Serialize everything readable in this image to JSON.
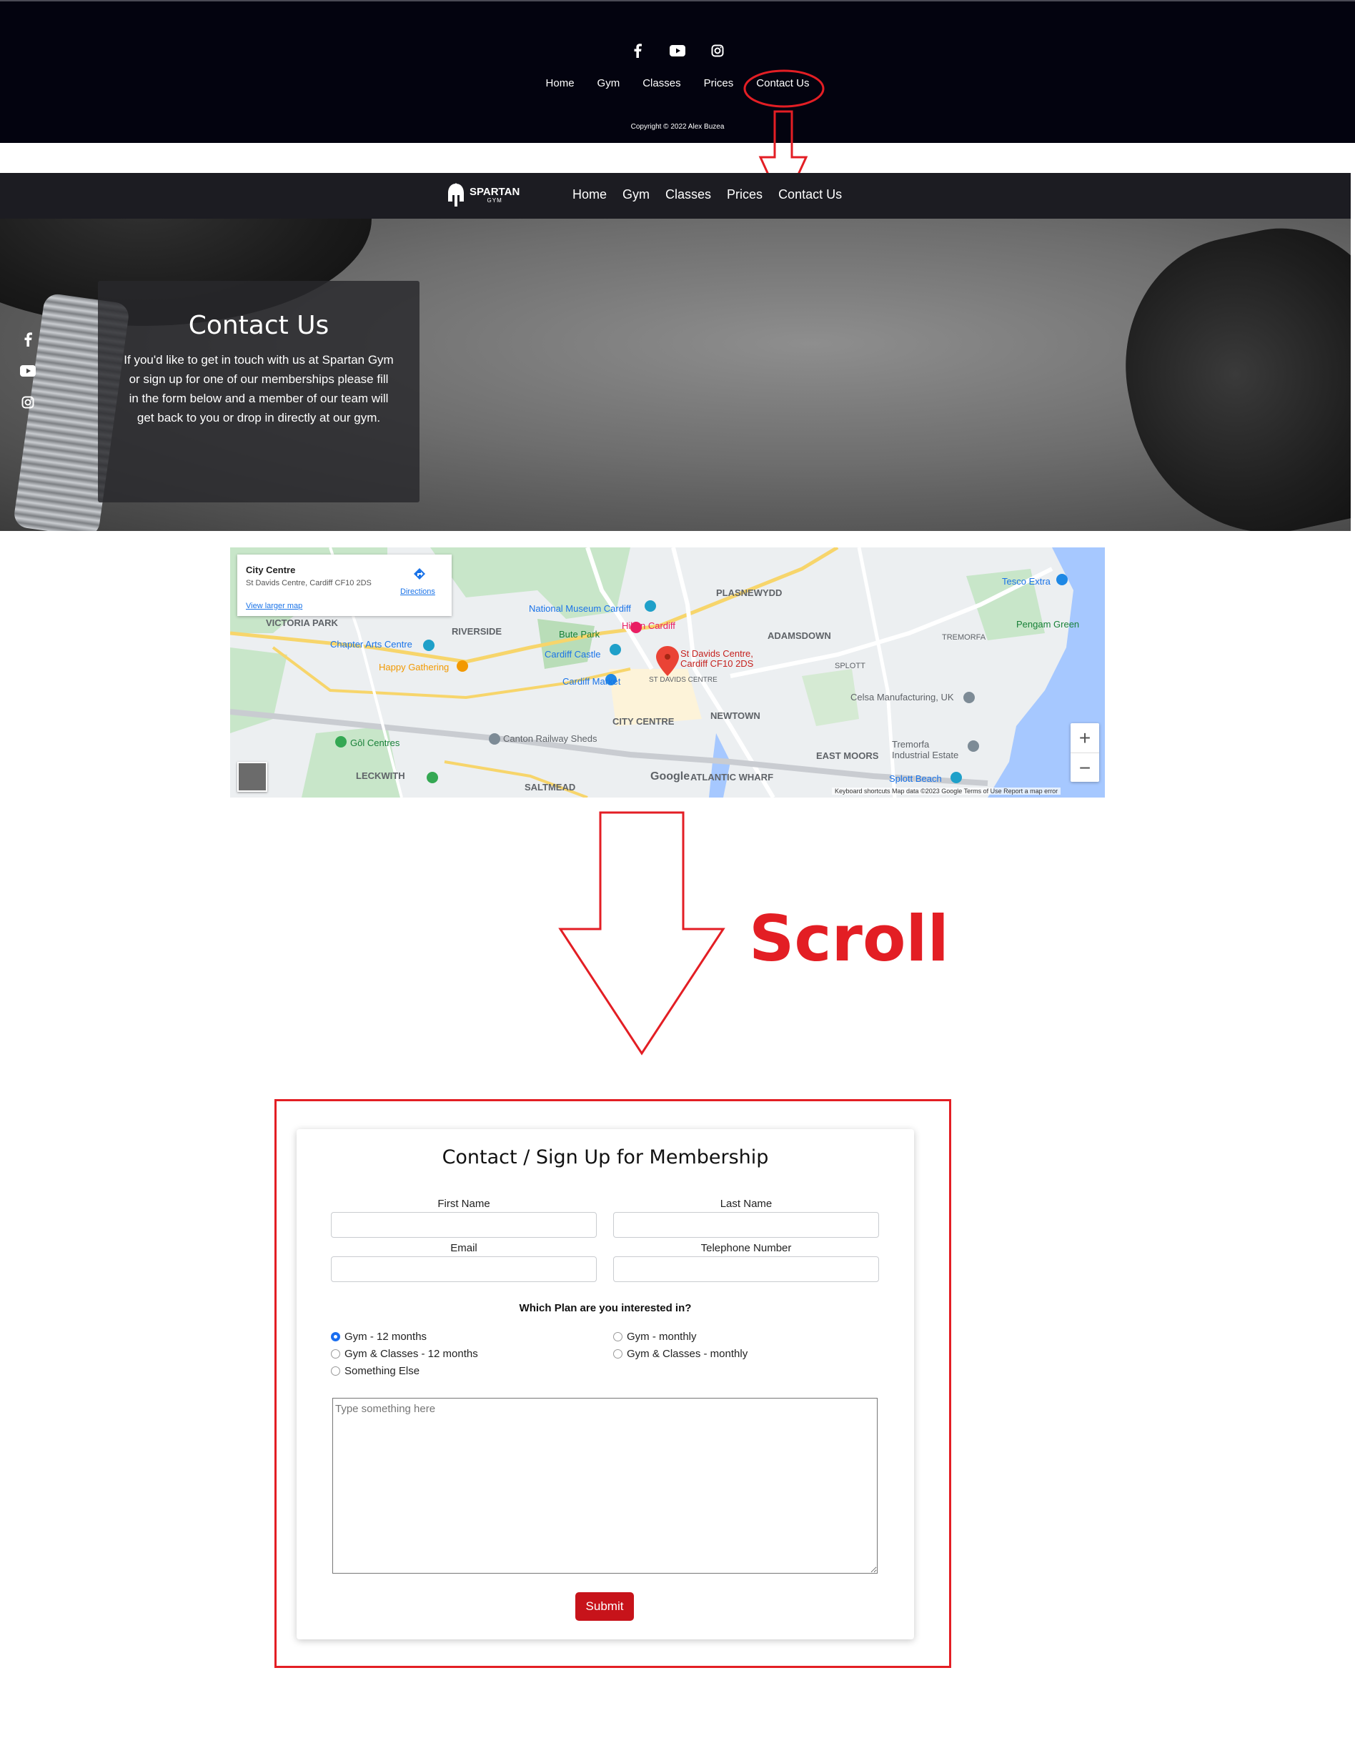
{
  "footer": {
    "social": [
      "facebook-icon",
      "youtube-icon",
      "instagram-icon"
    ],
    "nav": [
      "Home",
      "Gym",
      "Classes",
      "Prices",
      "Contact Us"
    ],
    "copyright": "Copyright © 2022 Alex Buzea"
  },
  "navbar": {
    "brand_title": "SPARTAN",
    "brand_sub": "GYM",
    "links": [
      "Home",
      "Gym",
      "Classes",
      "Prices",
      "Contact Us"
    ]
  },
  "hero": {
    "title": "Contact Us",
    "text": "If you'd like to get in touch with us at Spartan Gym or sign up for one of our memberships please fill in the form below and a member of our team will get back to you or drop in directly at our gym.",
    "social": [
      "facebook-icon",
      "youtube-icon",
      "instagram-icon"
    ]
  },
  "map": {
    "place_title": "City Centre",
    "address": "St Davids Centre, Cardiff CF10 2DS",
    "view_larger": "View larger map",
    "directions": "Directions",
    "marker_label": "St Davids Centre, Cardiff CF10 2DS",
    "labels": [
      "PLASNEWYDD",
      "ADAMSDOWN",
      "Tesco Extra",
      "Pengam Green",
      "National Museum Cardiff",
      "Hilton Cardiff",
      "Bute Park",
      "RIVERSIDE",
      "Chapter Arts Centre",
      "Cardiff Castle",
      "Happy Gathering",
      "Cardiff Market",
      "CITY CENTRE",
      "NEWTOWN",
      "SPLOTT",
      "TREMORFA",
      "Celsa Manufacturing, UK",
      "EAST MOORS",
      "Tremorfa Industrial Estate",
      "Splott Beach",
      "Canton Railway Sheds",
      "Gôl Centres",
      "LECKWITH",
      "SALTMEAD",
      "ATLANTIC WHARF",
      "VICTORIA PARK",
      "ST DAVIDS CENTRE"
    ],
    "footer": "Keyboard shortcuts   Map data ©2023 Google   Terms of Use   Report a map error",
    "google": "Google"
  },
  "annotation": {
    "scroll_text": "Scroll",
    "color": "#e31e24"
  },
  "form": {
    "title": "Contact / Sign Up for Membership",
    "first_name_label": "First Name",
    "last_name_label": "Last Name",
    "email_label": "Email",
    "telephone_label": "Telephone Number",
    "plan_question": "Which Plan are you interested in?",
    "plans": [
      {
        "label": "Gym - 12 months",
        "checked": true
      },
      {
        "label": "Gym - monthly",
        "checked": false
      },
      {
        "label": "Gym & Classes - 12 months",
        "checked": false
      },
      {
        "label": "Gym & Classes - monthly",
        "checked": false
      },
      {
        "label": "Something Else",
        "checked": false
      }
    ],
    "message_placeholder": "Type something here",
    "submit_label": "Submit",
    "submit_color": "#c7131a"
  }
}
